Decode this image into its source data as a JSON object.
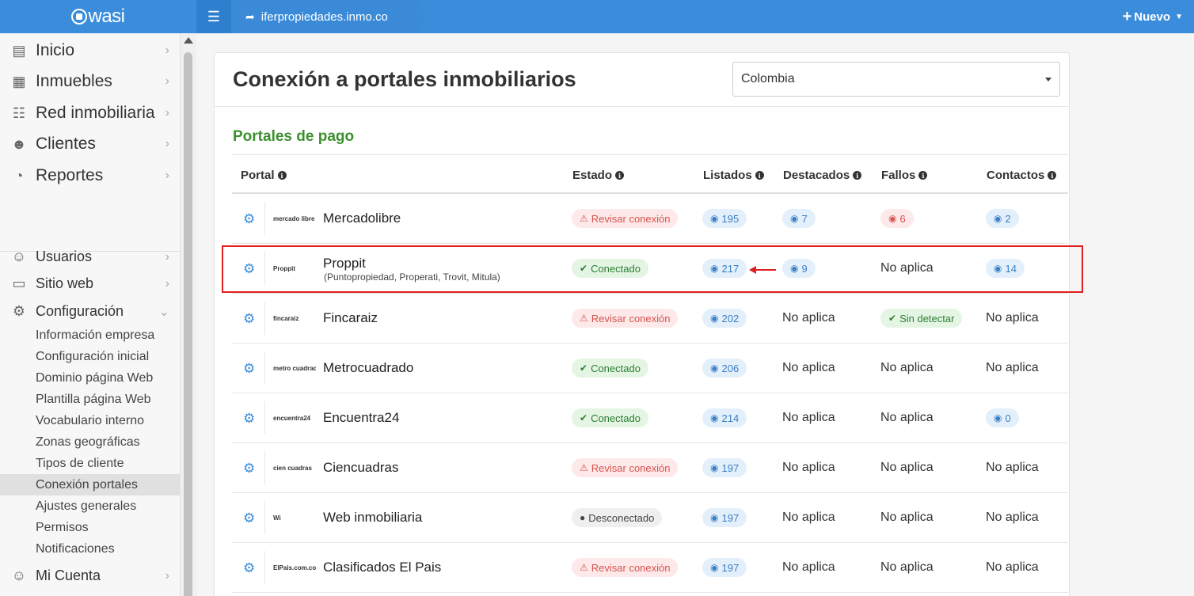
{
  "header": {
    "brand": "wasi",
    "domain": "iferpropiedades.inmo.co",
    "new_label": "Nuevo"
  },
  "sidebar": {
    "main_items": [
      {
        "label": "Inicio",
        "icon": "home-icon"
      },
      {
        "label": "Inmuebles",
        "icon": "building-icon"
      },
      {
        "label": "Red inmobiliaria",
        "icon": "network-icon"
      },
      {
        "label": "Clientes",
        "icon": "users-icon"
      },
      {
        "label": "Reportes",
        "icon": "pie-chart-icon"
      }
    ],
    "secondary_items": [
      {
        "label": "Usuarios",
        "icon": "user-icon"
      },
      {
        "label": "Sitio web",
        "icon": "monitor-icon"
      },
      {
        "label": "Configuración",
        "icon": "gear-icon"
      }
    ],
    "config_subitems": [
      "Información empresa",
      "Configuración inicial",
      "Dominio página Web",
      "Plantilla página Web",
      "Vocabulario interno",
      "Zonas geográficas",
      "Tipos de cliente",
      "Conexión portales",
      "Ajustes generales",
      "Permisos",
      "Notificaciones"
    ],
    "active_subitem": "Conexión portales",
    "account_item": {
      "label": "Mi Cuenta",
      "icon": "user-gear-icon"
    }
  },
  "page": {
    "title": "Conexión a portales inmobiliarios",
    "country_select": "Colombia",
    "section_title": "Portales de pago"
  },
  "table": {
    "columns": [
      "Portal",
      "Estado",
      "Listados",
      "Destacados",
      "Fallos",
      "Contactos"
    ],
    "rows": [
      {
        "name": "Mercadolibre",
        "subtitle": "",
        "logo": "mercado libre",
        "estado": {
          "type": "warn",
          "label": "Revisar conexión"
        },
        "listados": "195",
        "destacados": {
          "badge": "7"
        },
        "fallos": {
          "badge_red": "6"
        },
        "contactos": {
          "badge": "2"
        }
      },
      {
        "name": "Proppit",
        "subtitle": "(Puntopropiedad, Properati, Trovit, Mitula)",
        "logo": "Proppit",
        "estado": {
          "type": "ok",
          "label": "Conectado"
        },
        "listados": "217",
        "destacados": {
          "badge": "9"
        },
        "fallos": {
          "text": "No aplica"
        },
        "contactos": {
          "badge": "14"
        }
      },
      {
        "name": "Fincaraiz",
        "subtitle": "",
        "logo": "fincaraiz",
        "estado": {
          "type": "warn",
          "label": "Revisar conexión"
        },
        "listados": "202",
        "destacados": {
          "text": "No aplica"
        },
        "fallos": {
          "ok": "Sin detectar"
        },
        "contactos": {
          "text": "No aplica"
        }
      },
      {
        "name": "Metrocuadrado",
        "subtitle": "",
        "logo": "metro cuadrado",
        "estado": {
          "type": "ok",
          "label": "Conectado"
        },
        "listados": "206",
        "destacados": {
          "text": "No aplica"
        },
        "fallos": {
          "text": "No aplica"
        },
        "contactos": {
          "text": "No aplica"
        }
      },
      {
        "name": "Encuentra24",
        "subtitle": "",
        "logo": "encuentra24",
        "estado": {
          "type": "ok",
          "label": "Conectado"
        },
        "listados": "214",
        "destacados": {
          "text": "No aplica"
        },
        "fallos": {
          "text": "No aplica"
        },
        "contactos": {
          "badge": "0"
        }
      },
      {
        "name": "Ciencuadras",
        "subtitle": "",
        "logo": "cien cuadras",
        "estado": {
          "type": "warn",
          "label": "Revisar conexión"
        },
        "listados": "197",
        "destacados": {
          "text": "No aplica"
        },
        "fallos": {
          "text": "No aplica"
        },
        "contactos": {
          "text": "No aplica"
        }
      },
      {
        "name": "Web inmobiliaria",
        "subtitle": "",
        "logo": "Wi",
        "estado": {
          "type": "off",
          "label": "Desconectado"
        },
        "listados": "197",
        "destacados": {
          "text": "No aplica"
        },
        "fallos": {
          "text": "No aplica"
        },
        "contactos": {
          "text": "No aplica"
        }
      },
      {
        "name": "Clasificados El Pais",
        "subtitle": "",
        "logo": "ElPais.com.co",
        "estado": {
          "type": "warn",
          "label": "Revisar conexión"
        },
        "listados": "197",
        "destacados": {
          "text": "No aplica"
        },
        "fallos": {
          "text": "No aplica"
        },
        "contactos": {
          "text": "No aplica"
        }
      }
    ]
  },
  "colors": {
    "header_blue": "#3b8ddc",
    "section_green": "#3c8f2e",
    "highlight_red": "#e02020"
  }
}
